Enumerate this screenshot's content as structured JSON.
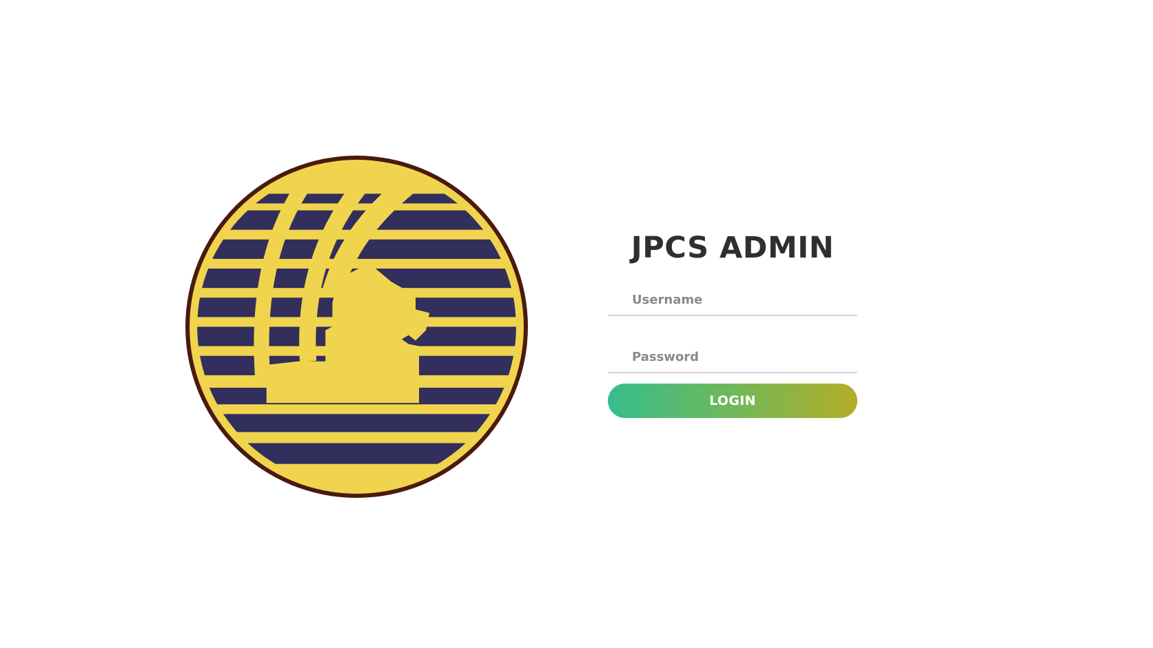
{
  "logo": {
    "name": "JPCS logo",
    "colors": {
      "ring": "#4a1a0e",
      "disc": "#f1d44e",
      "stripes": "#322f5c"
    }
  },
  "login": {
    "title": "JPCS ADMIN",
    "username_placeholder": "Username",
    "password_placeholder": "Password",
    "button_label": "LOGIN"
  },
  "colors": {
    "title_text": "#2f2f2f",
    "button_gradient_start": "#36bd8b",
    "button_gradient_end": "#b2ae26",
    "field_underline": "#d6d6d6"
  }
}
